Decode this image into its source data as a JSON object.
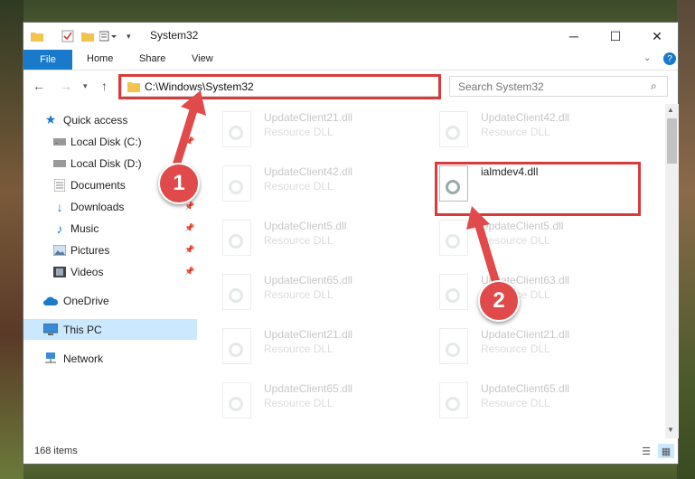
{
  "window": {
    "title": "System32"
  },
  "ribbon": {
    "file": "File",
    "tabs": [
      "Home",
      "Share",
      "View"
    ]
  },
  "address": {
    "path": "C:\\Windows\\System32"
  },
  "search": {
    "placeholder": "Search System32"
  },
  "sidebar": {
    "items": [
      {
        "label": "Quick access",
        "icon": "star-icon"
      },
      {
        "label": "Local Disk (C:)",
        "icon": "drive-icon"
      },
      {
        "label": "Local Disk (D:)",
        "icon": "drive-icon"
      },
      {
        "label": "Documents",
        "icon": "documents-icon"
      },
      {
        "label": "Downloads",
        "icon": "download-icon"
      },
      {
        "label": "Music",
        "icon": "music-icon"
      },
      {
        "label": "Pictures",
        "icon": "pictures-icon"
      },
      {
        "label": "Videos",
        "icon": "videos-icon"
      },
      {
        "label": "OneDrive",
        "icon": "cloud-icon"
      },
      {
        "label": "This PC",
        "icon": "computer-icon"
      },
      {
        "label": "Network",
        "icon": "network-icon"
      }
    ]
  },
  "files": {
    "col1": [
      {
        "name": "UpdateClient21.dll",
        "type": "Resource DLL"
      },
      {
        "name": "UpdateClient42.dll",
        "type": "Resource DLL"
      },
      {
        "name": "UpdateClient5.dll",
        "type": "Resource DLL"
      },
      {
        "name": "UpdateClient65.dll",
        "type": "Resource DLL"
      },
      {
        "name": "UpdateClient21.dll",
        "type": "Resource DLL"
      },
      {
        "name": "UpdateClient65.dll",
        "type": "Resource DLL"
      }
    ],
    "col2": [
      {
        "name": "UpdateClient42.dll",
        "type": "Resource DLL"
      },
      {
        "name": "ialmdev4.dll",
        "type": ""
      },
      {
        "name": "UpdateClient5.dll",
        "type": "Resource DLL"
      },
      {
        "name": "UpdateClient63.dll",
        "type": "Resource DLL"
      },
      {
        "name": "UpdateClient21.dll",
        "type": "Resource DLL"
      },
      {
        "name": "UpdateClient65.dll",
        "type": "Resource DLL"
      }
    ]
  },
  "status": {
    "count": "168 items"
  },
  "annotations": {
    "marker1": "1",
    "marker2": "2",
    "accent": "#d93b3b"
  }
}
